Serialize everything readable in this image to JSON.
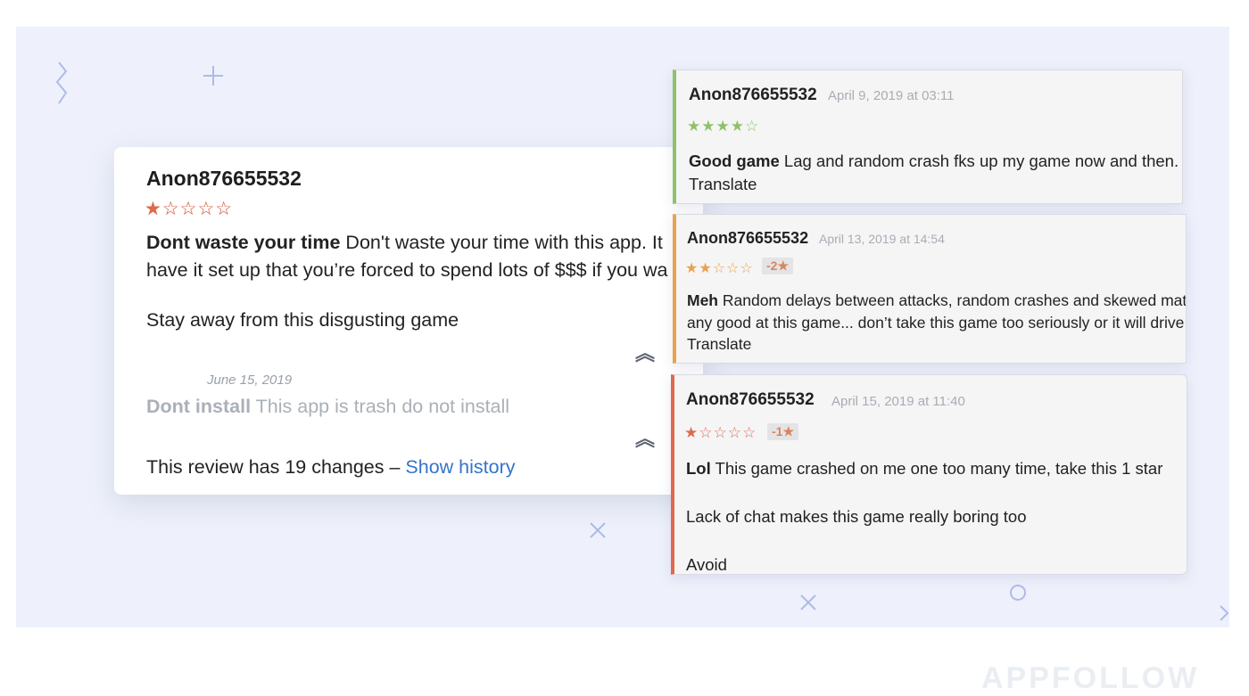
{
  "main_review": {
    "author": "Anon876655532",
    "stars": "★☆☆☆☆",
    "title": "Dont waste your time",
    "line1_rest": " Don't waste your time with this app. It",
    "line2": "have it set up that you’re forced to spend lots of $$$ if you wa",
    "paragraph2": "Stay away from this disgusting game",
    "previous": {
      "stars": "★☆☆☆☆",
      "date": "June 15, 2019",
      "title": "Dont install",
      "text": " This app is trash do not install"
    },
    "history_text": "This review has 19 changes – ",
    "history_link": "Show history"
  },
  "review_cards": [
    {
      "author": "Anon876655532",
      "date": "April 9, 2019 at 03:11",
      "stars": "★★★★☆",
      "title": "Good game",
      "text": " Lag and random crash fks up my game now and then. Be",
      "translate": "Translate",
      "accent": "#8ec26a"
    },
    {
      "author": "Anon876655532",
      "date": "April 13, 2019 at 14:54",
      "stars": "★★☆☆☆",
      "badge": "-2★",
      "title": "Meh",
      "text": " Random delays between attacks,  random crashes and skewed mat",
      "text2": "any good at this game... don’t take this game too seriously or it will drive",
      "translate": "Translate",
      "accent": "#e9a24f"
    },
    {
      "author": "Anon876655532",
      "date": "April 15, 2019 at 11:40",
      "stars": "★☆☆☆☆",
      "badge": "-1★",
      "title": "Lol",
      "text": " This game crashed on me one too many time, take this 1 star",
      "text2": "Lack of chat makes this game really boring too",
      "text3": "Avoid",
      "accent": "#dd6b4d"
    }
  ],
  "brand": "APPFOLLOW",
  "colors": {
    "background": "#eef1fb",
    "link": "#3474c9",
    "star_red": "#df6a4c",
    "star_green": "#8ec26a",
    "star_orange": "#e9a24f"
  }
}
